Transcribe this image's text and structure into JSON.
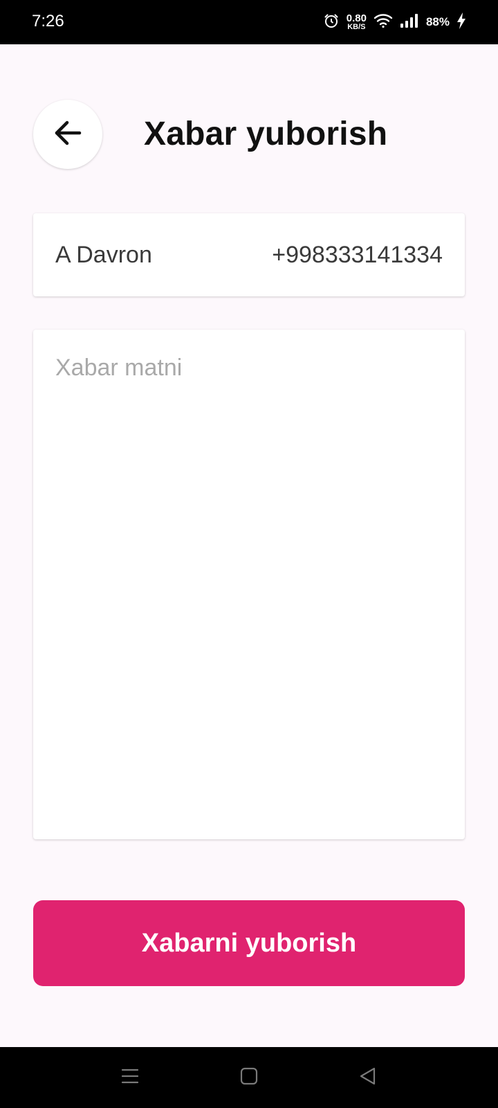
{
  "status_bar": {
    "time": "7:26",
    "net_speed_value": "0.80",
    "net_speed_unit": "KB/S",
    "battery": "88%",
    "icons": [
      "alarm-icon",
      "wifi-icon",
      "signal-icon",
      "charging-icon"
    ]
  },
  "header": {
    "title": "Xabar yuborish",
    "back_icon": "arrow-left-icon"
  },
  "contact": {
    "name": "A Davron",
    "phone": "+998333141334"
  },
  "message": {
    "placeholder": "Xabar matni",
    "value": ""
  },
  "actions": {
    "send_label": "Xabarni yuborish"
  },
  "nav_bar": {
    "icons": [
      "menu-icon",
      "home-icon",
      "back-icon"
    ]
  },
  "colors": {
    "accent": "#e0236f",
    "background": "#fdf8fc",
    "card": "#ffffff"
  }
}
